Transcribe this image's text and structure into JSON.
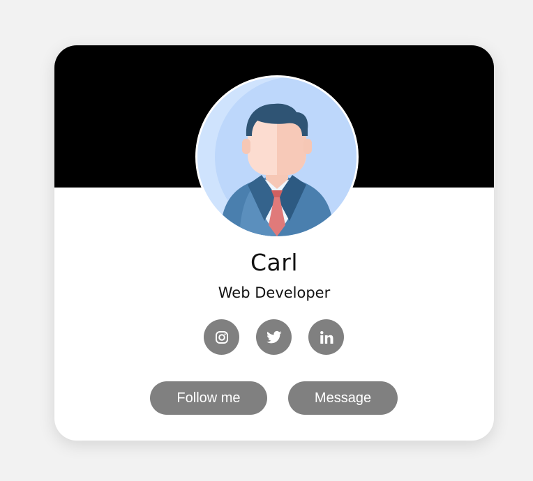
{
  "profile": {
    "name": "Carl",
    "role": "Web Developer"
  },
  "social": [
    {
      "icon": "instagram-icon"
    },
    {
      "icon": "twitter-icon"
    },
    {
      "icon": "linkedin-icon"
    }
  ],
  "buttons": {
    "follow_label": "Follow me",
    "message_label": "Message"
  },
  "colors": {
    "page_background": "#f2f2f2",
    "banner": "#000000",
    "card": "#ffffff",
    "control_gray": "#808080"
  }
}
